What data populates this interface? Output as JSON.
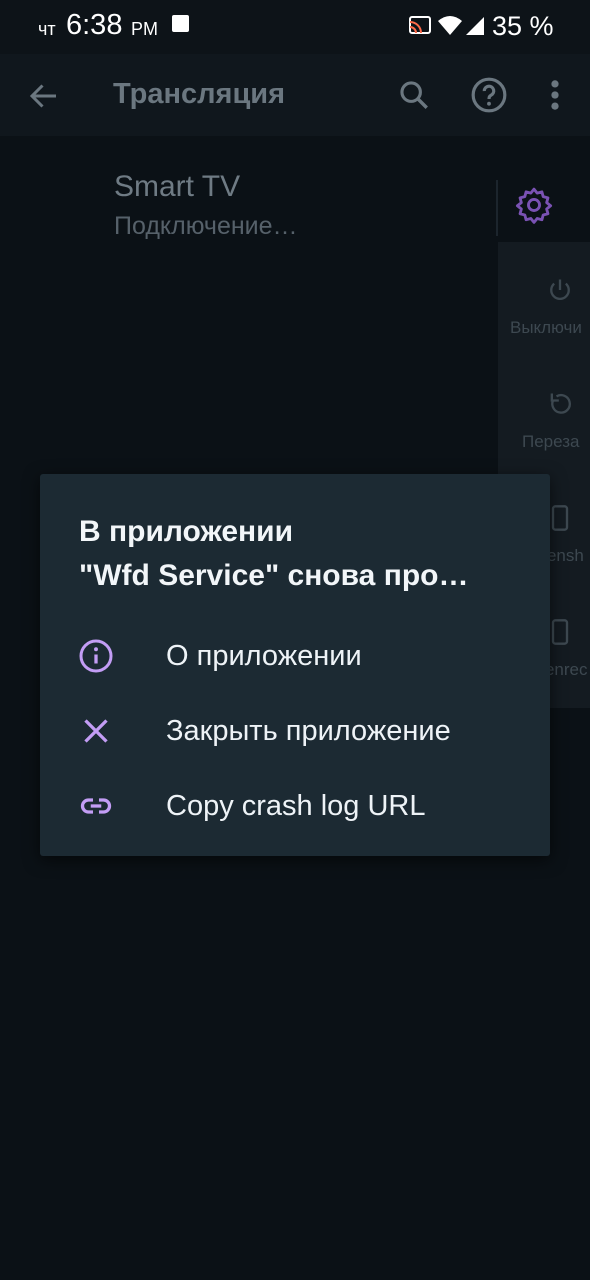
{
  "status_bar": {
    "day": "чт",
    "time": "6:38",
    "ampm": "PM",
    "battery": "35 %",
    "icons": [
      "notification-square-icon",
      "cast-icon",
      "wifi-icon",
      "signal-icon"
    ]
  },
  "app_bar": {
    "title": "Трансляция",
    "icons": [
      "back-arrow-icon",
      "search-icon",
      "help-icon",
      "more-vert-icon"
    ]
  },
  "device": {
    "name": "Smart TV",
    "status": "Подключение…",
    "settings_icon": "gear-icon"
  },
  "side_panel": {
    "items": [
      {
        "label": "Выключи",
        "icon": "power-icon"
      },
      {
        "label": "Переза",
        "icon": "restart-icon"
      },
      {
        "label": "Screensh",
        "icon": "phone-icon"
      },
      {
        "label": "Screenrec",
        "icon": "phone-icon"
      }
    ]
  },
  "dialog": {
    "title_line1": "В приложении",
    "title_line2": "\"Wfd Service\" снова про…",
    "options": [
      {
        "label": "О приложении",
        "icon": "info-icon"
      },
      {
        "label": "Закрыть приложение",
        "icon": "close-icon"
      },
      {
        "label": "Copy crash log URL",
        "icon": "link-icon"
      }
    ]
  },
  "colors": {
    "accent": "#c39df5",
    "dialog_bg": "#1c2a33",
    "background": "#0b1116"
  }
}
